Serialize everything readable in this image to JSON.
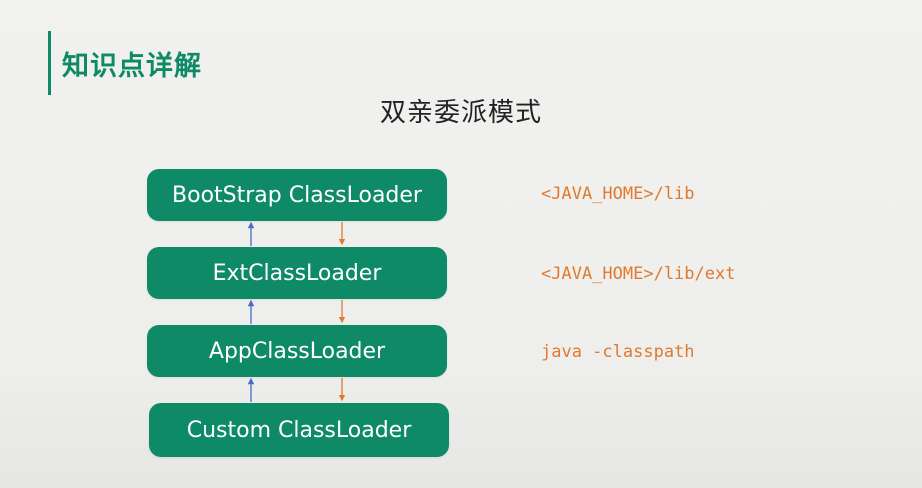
{
  "header": {
    "section_title": "知识点详解",
    "main_title": "双亲委派模式"
  },
  "diagram": {
    "loaders": [
      {
        "label": "BootStrap ClassLoader",
        "path": "<JAVA_HOME>/lib"
      },
      {
        "label": "ExtClassLoader",
        "path": "<JAVA_HOME>/lib/ext"
      },
      {
        "label": "AppClassLoader",
        "path": "java -classpath"
      },
      {
        "label": "Custom ClassLoader",
        "path": ""
      }
    ]
  },
  "colors": {
    "accent": "#0e8a66",
    "path_text": "#e07a2e",
    "up_arrow": "#4a6bc7",
    "down_arrow": "#e07a2e"
  },
  "icons": {
    "up_arrow": "arrow-up-icon",
    "down_arrow": "arrow-down-icon"
  }
}
